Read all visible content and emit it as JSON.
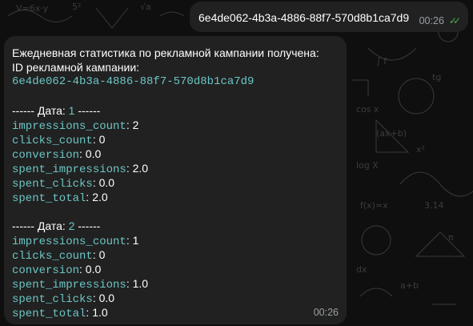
{
  "outgoing": {
    "text": "6e4de062-4b3a-4886-88f7-570d8b1ca7d9",
    "time": "00:26",
    "status": "read",
    "check_icon": "double-check-icon"
  },
  "incoming": {
    "header_line1": "Ежедневная статистика по рекламной кампании получена:",
    "header_line2": "ID рекламной кампании:",
    "campaign_id": "6e4de062-4b3a-4886-88f7-570d8b1ca7d9",
    "days": [
      {
        "label_prefix": "------ Дата: ",
        "day": "1",
        "label_suffix": " ------",
        "stats": [
          {
            "key": "impressions_count",
            "value": ": 2"
          },
          {
            "key": "clicks_count",
            "value": ": 0"
          },
          {
            "key": "conversion",
            "value": ": 0.0"
          },
          {
            "key": "spent_impressions",
            "value": ": 2.0"
          },
          {
            "key": "spent_clicks",
            "value": ": 0.0"
          },
          {
            "key": "spent_total",
            "value": ": 2.0"
          }
        ]
      },
      {
        "label_prefix": "------ Дата: ",
        "day": "2",
        "label_suffix": " ------",
        "stats": [
          {
            "key": "impressions_count",
            "value": ": 1"
          },
          {
            "key": "clicks_count",
            "value": ": 0"
          },
          {
            "key": "conversion",
            "value": ": 0.0"
          },
          {
            "key": "spent_impressions",
            "value": ": 1.0"
          },
          {
            "key": "spent_clicks",
            "value": ": 0.0"
          },
          {
            "key": "spent_total",
            "value": ": 1.0"
          }
        ]
      }
    ],
    "time": "00:26"
  },
  "colors": {
    "bubble": "#212121",
    "accent": "#6cc5c4",
    "check": "#4fae4e",
    "meta": "#9aa0a6"
  }
}
